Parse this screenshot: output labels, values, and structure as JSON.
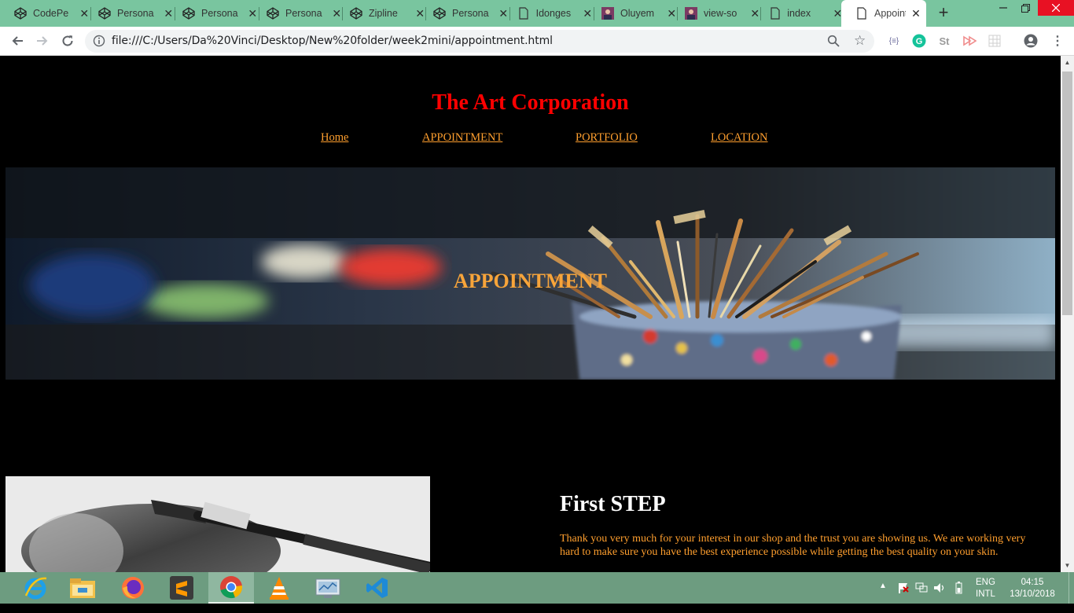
{
  "browser": {
    "tabs": [
      {
        "title": "CodePe",
        "icon": "codepen-icon"
      },
      {
        "title": "Persona",
        "icon": "codepen-icon"
      },
      {
        "title": "Persona",
        "icon": "codepen-icon"
      },
      {
        "title": "Persona",
        "icon": "codepen-icon"
      },
      {
        "title": "Zipline",
        "icon": "codepen-icon"
      },
      {
        "title": "Persona",
        "icon": "codepen-icon"
      },
      {
        "title": "Idonges",
        "icon": "document-icon"
      },
      {
        "title": "Oluyem",
        "icon": "avatar-icon"
      },
      {
        "title": "view-so",
        "icon": "avatar-icon"
      },
      {
        "title": "index",
        "icon": "document-icon"
      },
      {
        "title": "Appoint",
        "icon": "document-icon",
        "active": true
      }
    ],
    "url": "file:///C:/Users/Da%20Vinci/Desktop/New%20folder/week2mini/appointment.html",
    "extensions": [
      "json-viewer",
      "grammarly",
      "st",
      "video",
      "grid"
    ]
  },
  "page": {
    "site_title": "The Art Corporation",
    "nav": [
      {
        "label": "Home"
      },
      {
        "label": "APPOINTMENT"
      },
      {
        "label": "PORTFOLIO"
      },
      {
        "label": "LOCATION"
      }
    ],
    "hero_title": "APPOINTMENT",
    "step_title": "First STEP",
    "step_text": "Thank you very much for your interest in our shop and the trust you are showing us. We are working very hard to make sure you have the best experience possible while getting the best quality on your skin."
  },
  "taskbar": {
    "apps": [
      "internet-explorer",
      "file-explorer",
      "firefox",
      "sublime-text",
      "chrome",
      "vlc",
      "control-panel",
      "vscode"
    ],
    "lang_top": "ENG",
    "lang_bottom": "INTL",
    "time": "04:15",
    "date": "13/10/2018"
  },
  "colors": {
    "tabstrip": "#79c59f",
    "site_title": "#ff0000",
    "nav_link": "#ff9f2e",
    "hero_title": "#f7a43a",
    "taskbar": "#6d9c80"
  }
}
